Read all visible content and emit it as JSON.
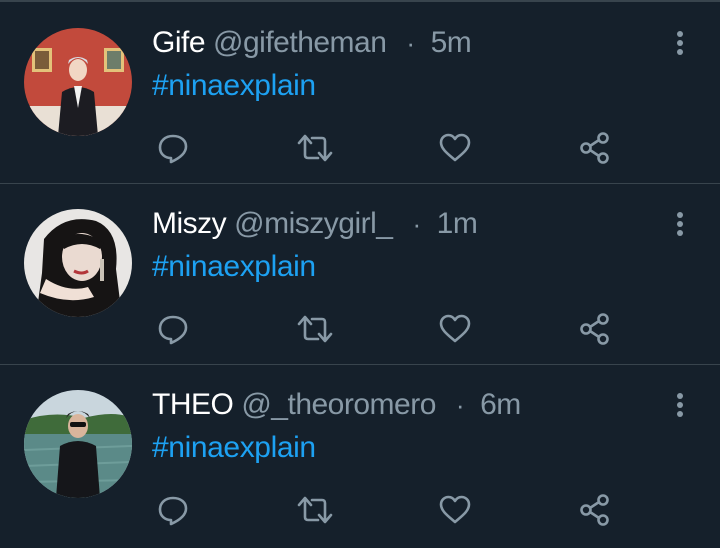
{
  "theme": {
    "background": "#15202b",
    "divider": "#38444d",
    "name_color": "#ffffff",
    "muted_color": "#8899a6",
    "link_color": "#1da1f2"
  },
  "tweets": [
    {
      "name": "Gife",
      "handle": "@gifetheman",
      "separator": "·",
      "time": "5m",
      "text": "#ninaexplain",
      "avatar_icon": "user-avatar"
    },
    {
      "name": "Miszy",
      "handle": "@miszygirl_",
      "separator": "·",
      "time": "1m",
      "text": "#ninaexplain",
      "avatar_icon": "user-avatar"
    },
    {
      "name": "THEO",
      "handle": "@_theoromero",
      "separator": "·",
      "time": "6m",
      "text": "#ninaexplain",
      "avatar_icon": "user-avatar"
    }
  ],
  "action_icons": [
    "reply-icon",
    "retweet-icon",
    "like-icon",
    "share-icon"
  ]
}
